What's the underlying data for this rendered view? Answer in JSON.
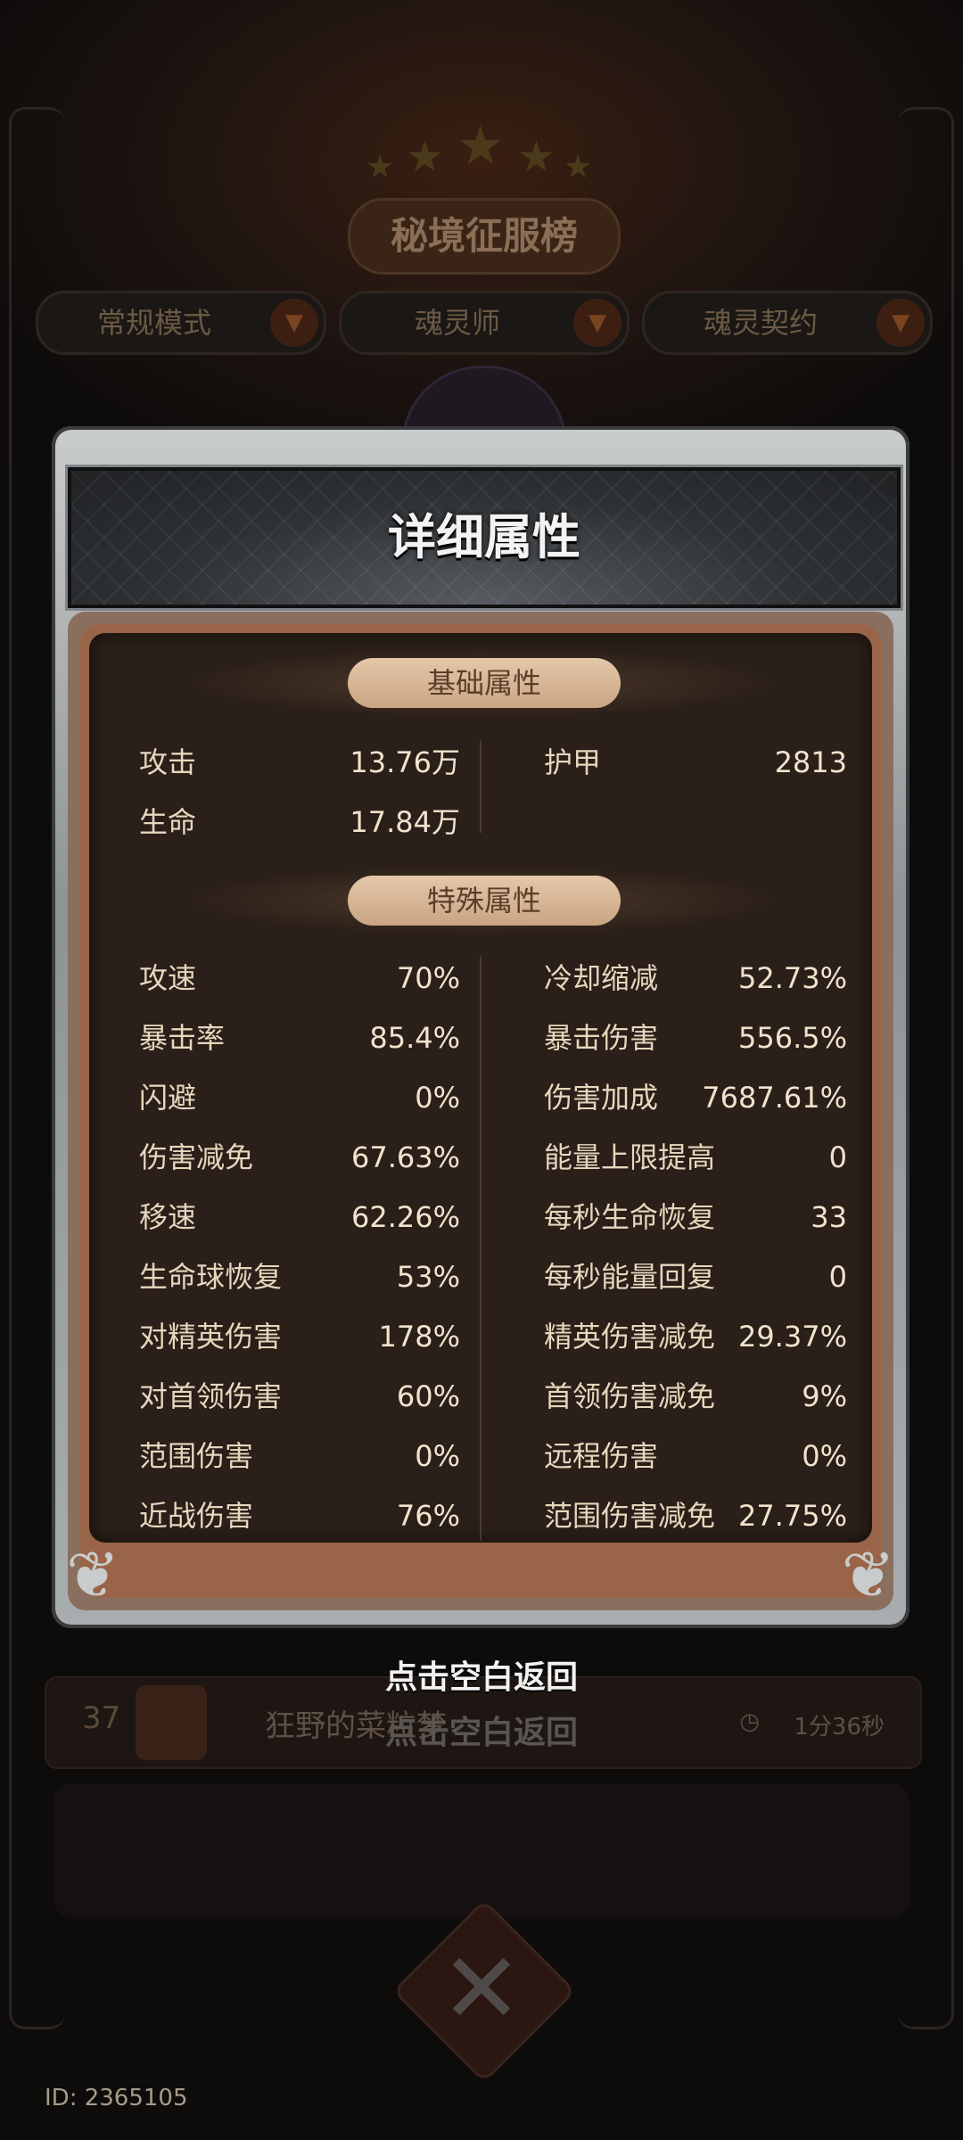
{
  "background": {
    "board_title": "秘境征服榜",
    "filters": [
      "常规模式",
      "魂灵师",
      "魂灵契约"
    ],
    "ranking_row": {
      "rank": "37",
      "player_name": "狂野的菜粒梦",
      "time": "1分36秒"
    },
    "user_id": "ID: 2365105"
  },
  "modal": {
    "title": "详细属性",
    "basic_section": {
      "label": "基础属性",
      "left": [
        {
          "key": "攻击",
          "value": "13.76万"
        },
        {
          "key": "生命",
          "value": "17.84万"
        }
      ],
      "right": [
        {
          "key": "护甲",
          "value": "2813"
        }
      ]
    },
    "special_section": {
      "label": "特殊属性",
      "left": [
        {
          "key": "攻速",
          "value": "70%"
        },
        {
          "key": "暴击率",
          "value": "85.4%"
        },
        {
          "key": "闪避",
          "value": "0%"
        },
        {
          "key": "伤害减免",
          "value": "67.63%"
        },
        {
          "key": "移速",
          "value": "62.26%"
        },
        {
          "key": "生命球恢复",
          "value": "53%"
        },
        {
          "key": "对精英伤害",
          "value": "178%"
        },
        {
          "key": "对首领伤害",
          "value": "60%"
        },
        {
          "key": "范围伤害",
          "value": "0%"
        },
        {
          "key": "近战伤害",
          "value": "76%"
        }
      ],
      "right": [
        {
          "key": "冷却缩减",
          "value": "52.73%"
        },
        {
          "key": "暴击伤害",
          "value": "556.5%"
        },
        {
          "key": "伤害加成",
          "value": "7687.61%"
        },
        {
          "key": "能量上限提高",
          "value": "0"
        },
        {
          "key": "每秒生命恢复",
          "value": "33"
        },
        {
          "key": "每秒能量回复",
          "value": "0"
        },
        {
          "key": "精英伤害减免",
          "value": "29.37%"
        },
        {
          "key": "首领伤害减免",
          "value": "9%"
        },
        {
          "key": "远程伤害",
          "value": "0%"
        },
        {
          "key": "范围伤害减免",
          "value": "27.75%"
        }
      ]
    }
  },
  "return_hint": "点击空白返回"
}
